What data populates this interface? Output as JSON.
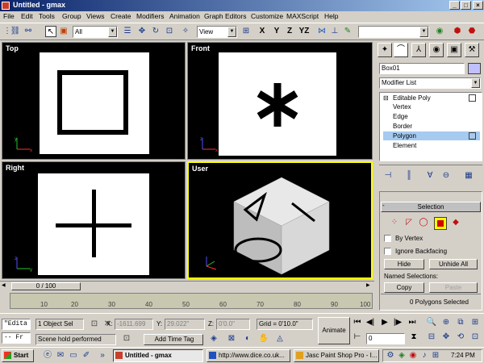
{
  "window": {
    "title": "Untitled - gmax",
    "controls": [
      "_",
      "□",
      "×"
    ]
  },
  "menu": [
    "File",
    "Edit",
    "Tools",
    "Group",
    "Views",
    "Create",
    "Modifiers",
    "Animation",
    "Graph Editors",
    "Customize",
    "MAXScript",
    "Help"
  ],
  "toolbar": {
    "selection_filter": "All",
    "ref_coord": "View",
    "axis_x": "X",
    "axis_y": "Y",
    "axis_z": "Z",
    "axis_yz": "YZ",
    "named_sel": ""
  },
  "viewports": {
    "top": "Top",
    "front": "Front",
    "right": "Right",
    "user": "User"
  },
  "command_panel": {
    "object_name": "Box01",
    "modifier_list": "Modifier List",
    "stack_root": "Editable Poly",
    "stack_items": [
      "Vertex",
      "Edge",
      "Border",
      "Polygon",
      "Element"
    ],
    "selected_item": "Polygon",
    "rollout_title": "Selection",
    "by_vertex": "By Vertex",
    "ignore_backfacing": "Ignore Backfacing",
    "hide": "Hide",
    "unhide_all": "Unhide All",
    "named_selections": "Named Selections:",
    "copy": "Copy",
    "paste": "Paste",
    "selection_status": "0 Polygons Selected"
  },
  "timeline": {
    "frame_indicator": "0 / 100",
    "ticks": [
      "10",
      "20",
      "30",
      "40",
      "50",
      "60",
      "70",
      "80",
      "90",
      "100"
    ]
  },
  "status": {
    "maxscript_line1": "\"Edita",
    "maxscript_line2": "-- Fr",
    "selection": "1 Object Sel",
    "x_label": "X:",
    "x_value": "-1611.699",
    "y_label": "Y:",
    "y_value": "29.022\"",
    "z_label": "Z:",
    "z_value": "0'0.0\"",
    "grid": "Grid = 0'10.0\"",
    "prompt": "Scene hold performed",
    "add_time_tag": "Add Time Tag",
    "animate": "Animate",
    "frame_value": "0"
  },
  "taskbar": {
    "start": "Start",
    "tasks": [
      "Untitled - gmax",
      "http://www.dice.co.uk...",
      "Jasc Paint Shop Pro - I..."
    ],
    "clock": "7:24 PM"
  }
}
